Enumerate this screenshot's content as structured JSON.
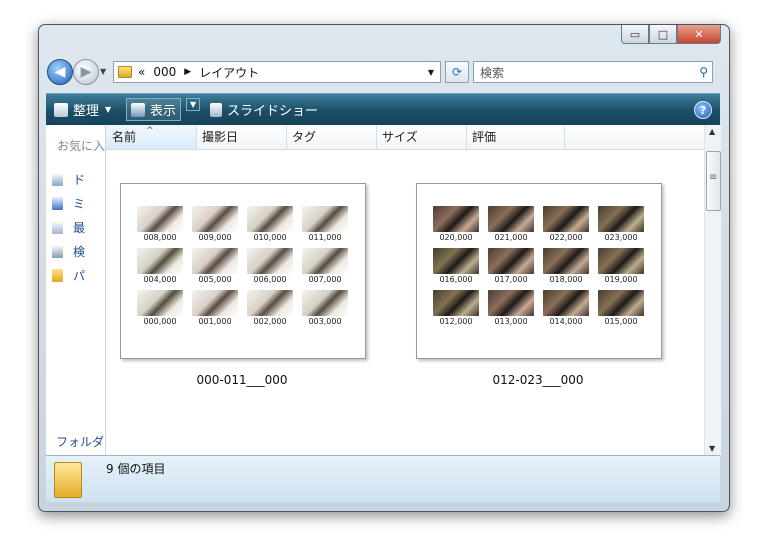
{
  "window": {
    "buttons": {
      "minimize": "▭",
      "maximize": "□",
      "close": "✕"
    }
  },
  "nav": {
    "address": {
      "overflow": "«",
      "crumbs": [
        "000",
        "レイアウト"
      ],
      "separator": "▶"
    },
    "search_placeholder": "検索"
  },
  "toolbar": {
    "organize": "整理",
    "view": "表示",
    "slideshow": "スライドショー",
    "help": "?"
  },
  "sidebar": {
    "favorites_title": "お気に入りリンク",
    "items": [
      {
        "label": "ド",
        "icon": "documents-icon"
      },
      {
        "label": "ミ",
        "icon": "music-icon"
      },
      {
        "label": "最",
        "icon": "recent-icon"
      },
      {
        "label": "検",
        "icon": "search-folder-icon"
      },
      {
        "label": "パ",
        "icon": "folder-icon"
      }
    ],
    "folders_label": "フォルダ"
  },
  "columns": [
    "名前",
    "撮影日",
    "タグ",
    "サイズ",
    "評価"
  ],
  "files": [
    {
      "name": "000-011___000",
      "tone": "light",
      "thumbs": [
        "008,000",
        "009,000",
        "010,000",
        "011,000",
        "004,000",
        "005,000",
        "006,000",
        "007,000",
        "000,000",
        "001,000",
        "002,000",
        "003,000"
      ]
    },
    {
      "name": "012-023___000",
      "tone": "dark",
      "thumbs": [
        "020,000",
        "021,000",
        "022,000",
        "023,000",
        "016,000",
        "017,000",
        "018,000",
        "019,000",
        "012,000",
        "013,000",
        "014,000",
        "015,000"
      ]
    }
  ],
  "status": {
    "count": "9 個の項目"
  },
  "colors": {
    "toolbar": "#1c4d66",
    "link": "#1e4e8f",
    "details": "#cfe2f0"
  }
}
